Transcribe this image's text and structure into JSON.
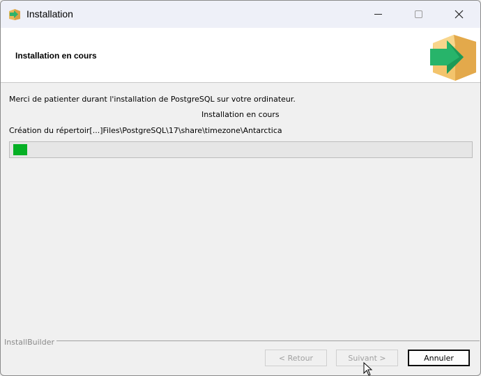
{
  "window": {
    "title": "Installation",
    "controls": [
      "minimize-icon",
      "maximize-icon",
      "close-icon"
    ]
  },
  "header": {
    "title": "Installation en cours",
    "icon": "install-box-arrow-icon"
  },
  "body": {
    "message": "Merci de patienter durant l'installation de PostgreSQL sur votre ordinateur.",
    "status": "Installation en cours",
    "current_path": "Création du répertoir[...]Files\\PostgreSQL\\17\\share\\timezone\\Antarctica",
    "progress": 0.03
  },
  "footer": {
    "brand": "InstallBuilder",
    "back_label": "< Retour",
    "next_label": "Suivant >",
    "cancel_label": "Annuler"
  },
  "colors": {
    "progress_fill": "#06b025",
    "header_bg": "#ffffff",
    "window_bg": "#f0f0f0"
  }
}
